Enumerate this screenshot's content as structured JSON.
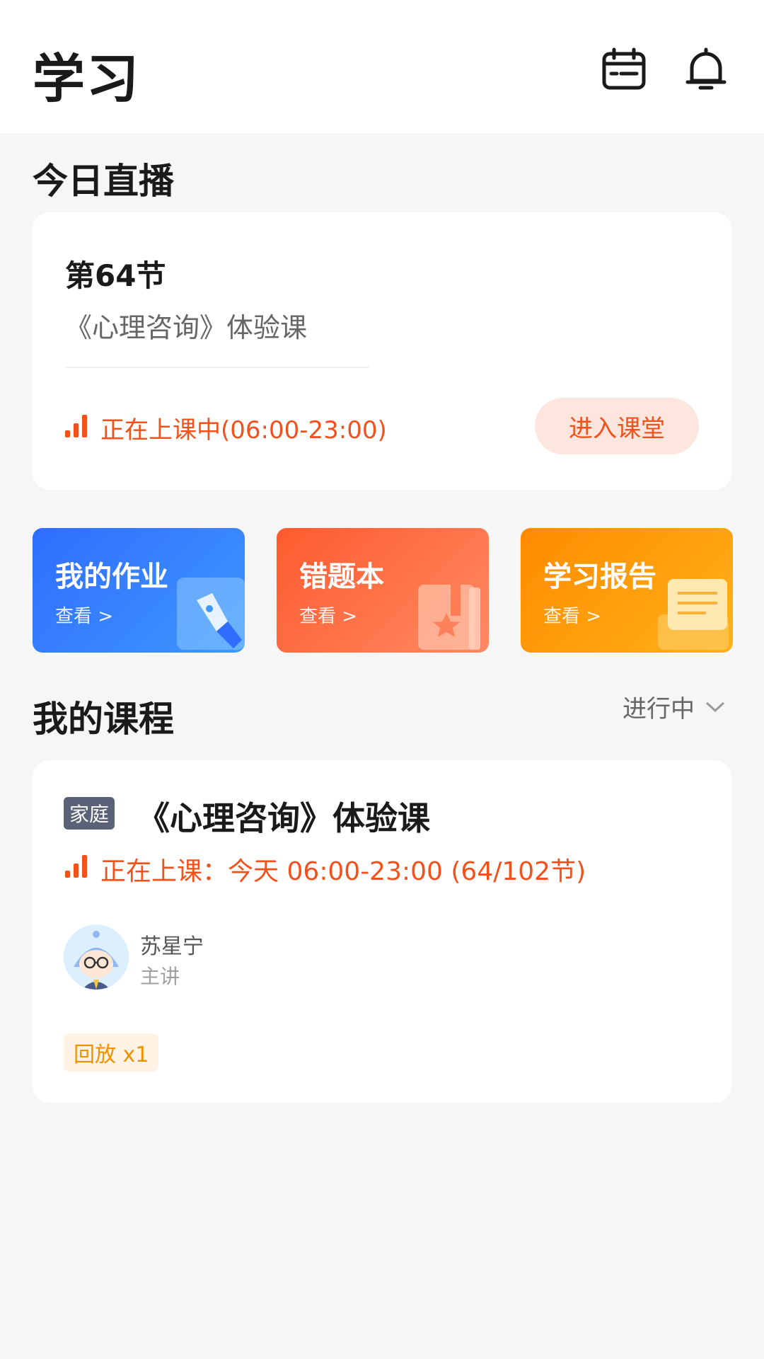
{
  "header": {
    "title": "学习",
    "icons": [
      "calendar-icon",
      "bell-icon"
    ]
  },
  "live": {
    "section_title": "今日直播",
    "lesson_no": "第64节",
    "course": "《心理咨询》体验课",
    "status": "正在上课中(06:00-23:00)",
    "enter_label": "进入课堂"
  },
  "shortcuts": [
    {
      "title": "我的作业",
      "sub": "查看 >",
      "icon": "pen-icon"
    },
    {
      "title": "错题本",
      "sub": "查看 >",
      "icon": "notebook-icon"
    },
    {
      "title": "学习报告",
      "sub": "查看 >",
      "icon": "report-icon"
    }
  ],
  "courses": {
    "section_title": "我的课程",
    "filter": "进行中",
    "items": [
      {
        "tag": "家庭",
        "title": "《心理咨询》体验课",
        "status": "正在上课：今天 06:00-23:00 (64/102节)",
        "teacher_name": "苏星宁",
        "teacher_role": "主讲",
        "replay": "回放 x1"
      }
    ]
  },
  "colors": {
    "accent": "#f2511c",
    "homework_tile": "#2f6dff",
    "mistakes_tile": "#ff5a2e",
    "report_tile": "#ff8a00",
    "tag_bg": "#5b6277",
    "replay": "#f29100"
  }
}
